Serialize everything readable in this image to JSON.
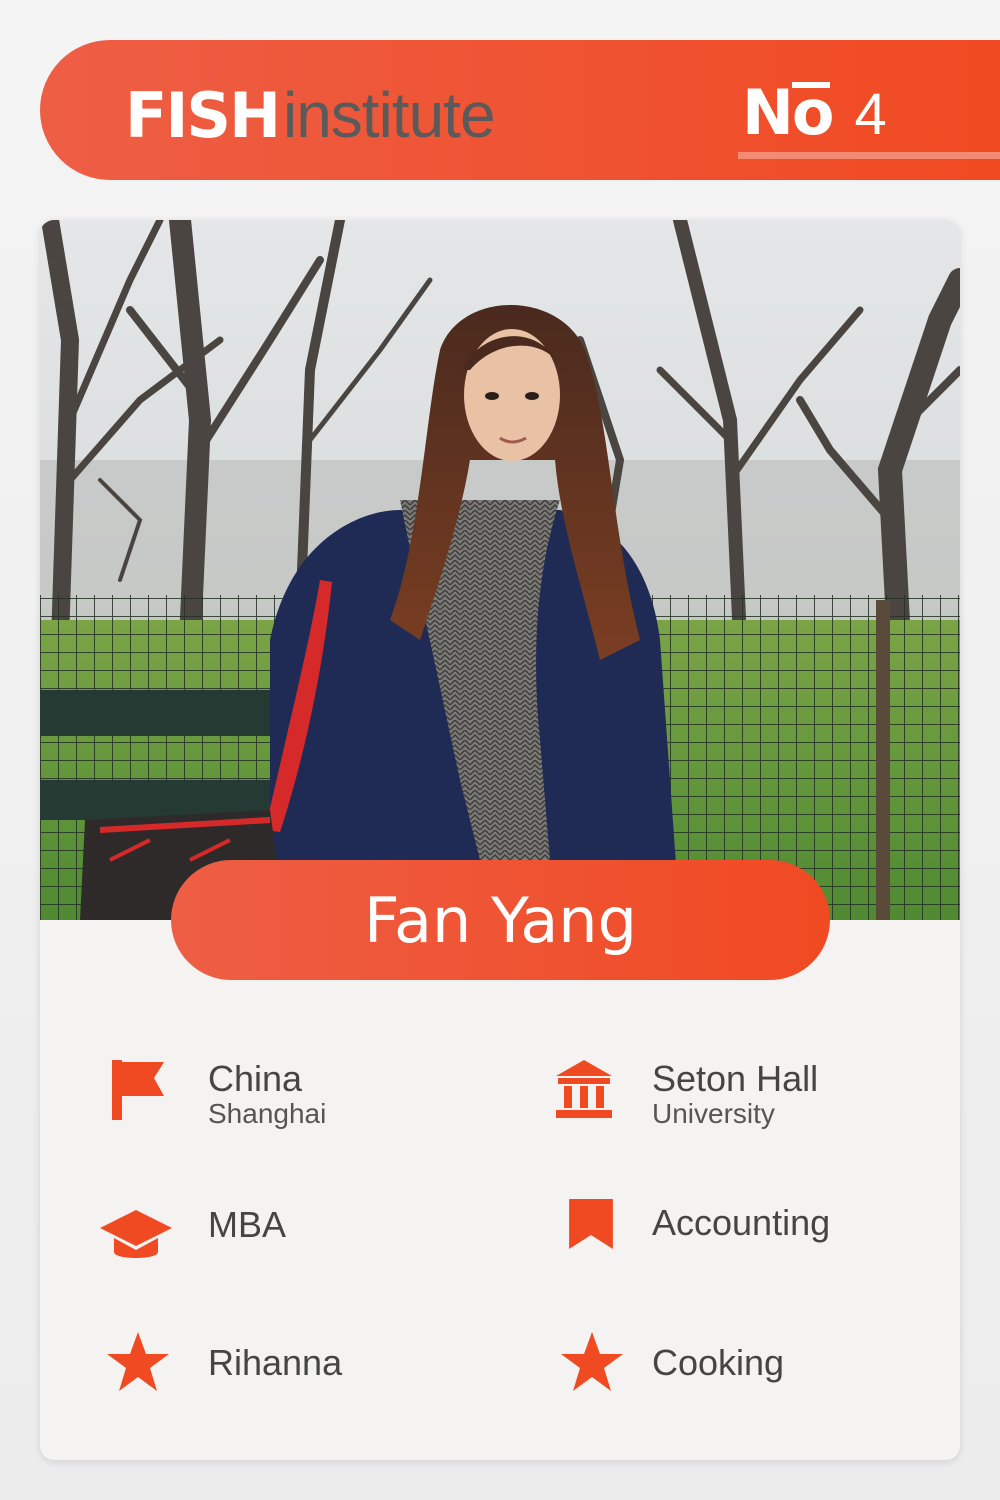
{
  "header": {
    "brand_bold": "FISH",
    "brand_light": "institute",
    "number_label": "No",
    "number_value": "4"
  },
  "profile": {
    "name": "Fan Yang",
    "photo_description_icon": "portrait-photo"
  },
  "details": {
    "country": {
      "title": "China",
      "subtitle": "Shanghai",
      "icon": "flag-icon"
    },
    "school": {
      "title": "Seton Hall",
      "subtitle": "University",
      "icon": "institution-icon"
    },
    "degree": {
      "title": "MBA",
      "icon": "graduation-cap-icon"
    },
    "major": {
      "title": "Accounting",
      "icon": "bookmark-icon"
    },
    "favorite_artist": {
      "title": "Rihanna",
      "icon": "star-icon"
    },
    "hobby": {
      "title": "Cooking",
      "icon": "star-icon"
    }
  },
  "colors": {
    "accent": "#f04a22",
    "accent_light": "#ee5e45",
    "card_bg": "#f4f3f1",
    "text": "#454545"
  }
}
